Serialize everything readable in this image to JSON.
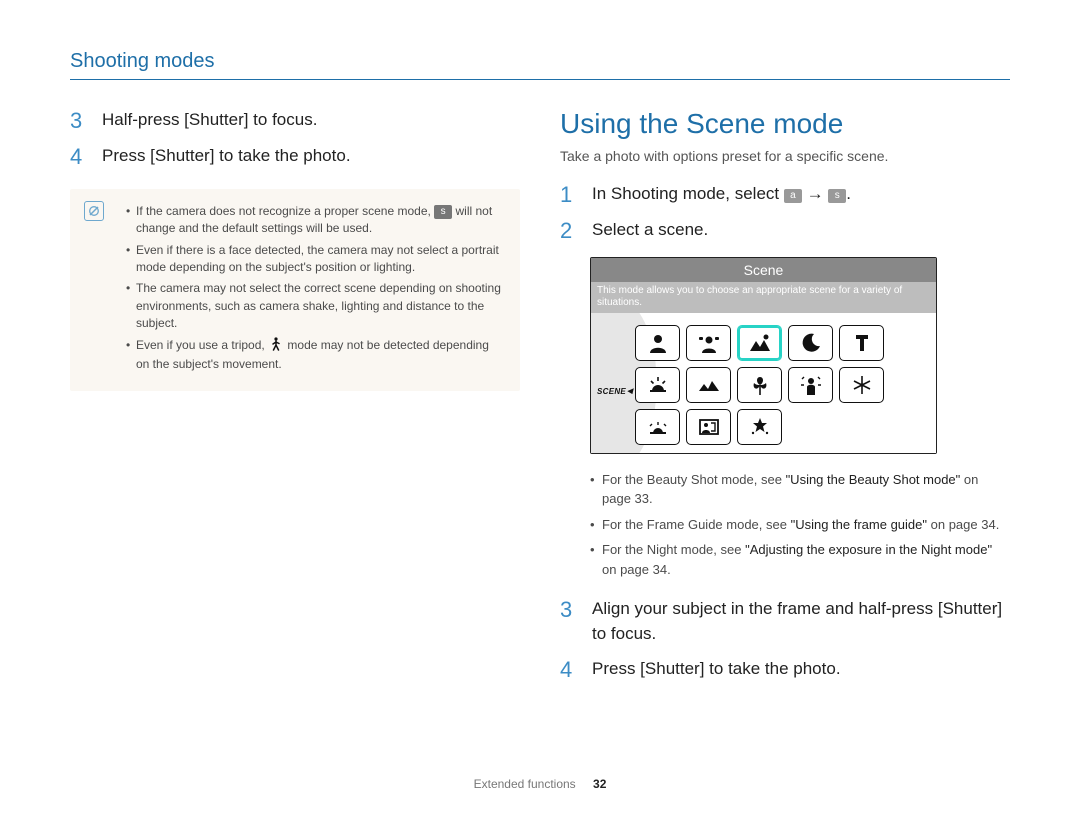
{
  "header": {
    "section_title": "Shooting modes"
  },
  "left": {
    "steps": [
      {
        "num": "3",
        "text_a": "Half-press [",
        "shutter": "Shutter",
        "text_b": "] to focus."
      },
      {
        "num": "4",
        "text_a": "Press [",
        "shutter": "Shutter",
        "text_b": "] to take the photo."
      }
    ],
    "info": {
      "bullets": [
        {
          "pre": "If the camera does not recognize a proper scene mode, ",
          "badge": "s",
          "post": " will not change and the default settings will be used."
        },
        {
          "text": "Even if there is a face detected, the camera may not select a portrait mode depending on the subject's position or lighting."
        },
        {
          "text": "The camera may not select the correct scene depending on shooting environments, such as camera shake, lighting and distance to the subject."
        },
        {
          "pre": "Even if you use a tripod, ",
          "icon": "person-walk",
          "post": " mode may not be detected depending on the subject's movement."
        }
      ]
    }
  },
  "right": {
    "heading": "Using the Scene mode",
    "sub": "Take a photo with options preset for a specific scene.",
    "step1": {
      "num": "1",
      "text_a": "In Shooting mode, select ",
      "a_label": "a",
      "arrow": " → ",
      "s_label": "s",
      "text_b": "."
    },
    "step2": {
      "num": "2",
      "text": "Select a scene."
    },
    "lcd": {
      "title": "Scene",
      "desc": "This mode allows you to choose an appropriate scene for a variety of situations.",
      "side_label": "SCENE",
      "icons": [
        "portrait",
        "children",
        "landscape",
        "close-up",
        "text",
        "sunset",
        "dawn",
        "backlight",
        "fireworks",
        "beach-snow"
      ],
      "selected_index": 2
    },
    "sub_bullets": [
      {
        "pre": "For the Beauty Shot mode, see ",
        "emph": "\"Using the Beauty Shot mode\"",
        "post": " on page 33."
      },
      {
        "pre": "For the Frame Guide mode, see ",
        "emph": "\"Using the frame guide\"",
        "post": " on page 34."
      },
      {
        "pre": "For the Night mode, see ",
        "emph": "\"Adjusting the exposure in the Night mode\"",
        "post": " on page 34."
      }
    ],
    "step3": {
      "num": "3",
      "text_a": "Align your subject in the frame and half-press [",
      "shutter": "Shutter",
      "text_b": "] to focus."
    },
    "step4": {
      "num": "4",
      "text_a": "Press [",
      "shutter": "Shutter",
      "text_b": "] to take the photo."
    }
  },
  "footer": {
    "label": "Extended functions",
    "page": "32"
  }
}
